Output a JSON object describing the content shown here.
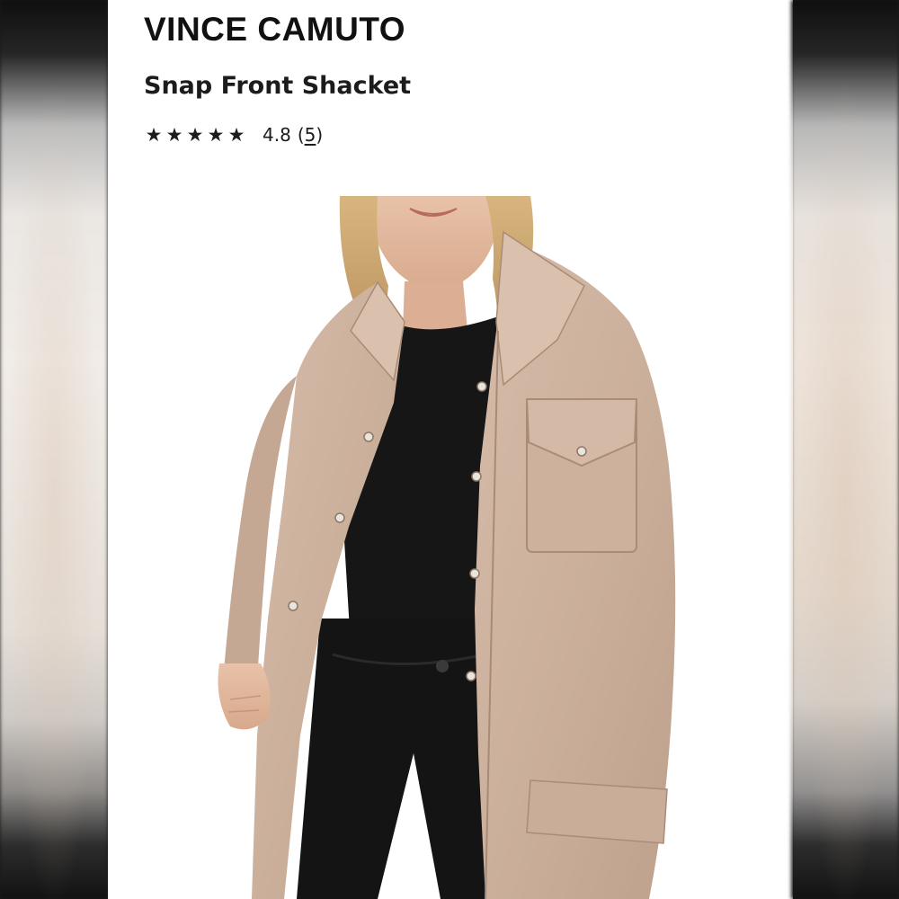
{
  "product": {
    "brand": "VINCE CAMUTO",
    "name": "Snap Front Shacket",
    "rating_stars": 5,
    "rating_value": "4.8",
    "review_open": "(",
    "review_count": "5",
    "review_close": ")"
  },
  "icons": {
    "star": "star-icon"
  },
  "colors": {
    "page_background": "#ffffff",
    "jacket": "#cdb3a0",
    "top": "#161616"
  }
}
